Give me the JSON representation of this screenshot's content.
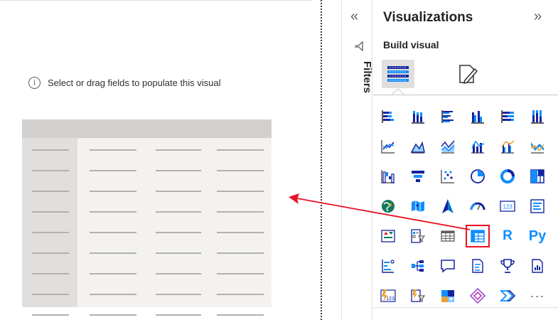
{
  "canvas": {
    "placeholder_text": "Select or drag fields to populate this visual",
    "table_placeholder": {
      "columns": 4,
      "rows": 9
    }
  },
  "filters_pane": {
    "label": "Filters",
    "collapse_glyph": "«"
  },
  "visualizations_pane": {
    "title": "Visualizations",
    "expand_glyph": "»",
    "build_visual_label": "Build visual",
    "tabs": [
      {
        "name": "build-visual",
        "icon": "build-visual-icon",
        "selected": true
      },
      {
        "name": "format-visual",
        "icon": "format-visual-icon",
        "selected": false
      }
    ],
    "gallery": [
      [
        {
          "name": "stacked-bar-chart",
          "icon": "stacked-bar-chart-icon"
        },
        {
          "name": "stacked-column-chart",
          "icon": "stacked-column-chart-icon"
        },
        {
          "name": "clustered-bar-chart",
          "icon": "clustered-bar-chart-icon"
        },
        {
          "name": "clustered-column-chart",
          "icon": "clustered-column-chart-icon"
        },
        {
          "name": "100-stacked-bar-chart",
          "icon": "100-stacked-bar-chart-icon"
        },
        {
          "name": "100-stacked-column-chart",
          "icon": "100-stacked-column-chart-icon"
        }
      ],
      [
        {
          "name": "line-chart",
          "icon": "line-chart-icon"
        },
        {
          "name": "area-chart",
          "icon": "area-chart-icon"
        },
        {
          "name": "stacked-area-chart",
          "icon": "stacked-area-chart-icon"
        },
        {
          "name": "line-and-stacked-column-chart",
          "icon": "line-and-stacked-column-chart-icon"
        },
        {
          "name": "line-and-clustered-column-chart",
          "icon": "line-and-clustered-column-chart-icon"
        },
        {
          "name": "ribbon-chart",
          "icon": "ribbon-chart-icon"
        }
      ],
      [
        {
          "name": "waterfall-chart",
          "icon": "waterfall-chart-icon"
        },
        {
          "name": "funnel",
          "icon": "funnel-icon"
        },
        {
          "name": "scatter-chart",
          "icon": "scatter-chart-icon"
        },
        {
          "name": "pie-chart",
          "icon": "pie-chart-icon"
        },
        {
          "name": "donut-chart",
          "icon": "donut-chart-icon"
        },
        {
          "name": "treemap",
          "icon": "treemap-icon"
        }
      ],
      [
        {
          "name": "map",
          "icon": "map-icon"
        },
        {
          "name": "filled-map",
          "icon": "filled-map-icon"
        },
        {
          "name": "azure-map",
          "icon": "azure-map-icon"
        },
        {
          "name": "gauge",
          "icon": "gauge-icon"
        },
        {
          "name": "card",
          "icon": "card-icon",
          "text": "123"
        },
        {
          "name": "multi-row-card",
          "icon": "multi-row-card-icon"
        }
      ],
      [
        {
          "name": "kpi",
          "icon": "kpi-icon"
        },
        {
          "name": "slicer",
          "icon": "slicer-icon"
        },
        {
          "name": "table",
          "icon": "table-icon"
        },
        {
          "name": "matrix",
          "icon": "matrix-icon",
          "selected": true
        },
        {
          "name": "r-script-visual",
          "icon": "r-icon",
          "text": "R"
        },
        {
          "name": "python-visual",
          "icon": "python-icon",
          "text": "Py"
        }
      ],
      [
        {
          "name": "key-influencers",
          "icon": "key-influencers-icon"
        },
        {
          "name": "decomposition-tree",
          "icon": "decomposition-tree-icon"
        },
        {
          "name": "qa",
          "icon": "qa-icon"
        },
        {
          "name": "smart-narrative",
          "icon": "smart-narrative-icon"
        },
        {
          "name": "metrics",
          "icon": "trophy-icon"
        },
        {
          "name": "paginated-report",
          "icon": "paginated-report-icon"
        }
      ],
      [
        {
          "name": "power-apps",
          "icon": "power-apps-icon",
          "text": "123"
        },
        {
          "name": "power-automate",
          "icon": "power-automate-icon"
        },
        {
          "name": "azure-ml",
          "icon": "azure-ml-icon"
        },
        {
          "name": "custom-visual-diamond",
          "icon": "diamond-icon"
        },
        {
          "name": "power-automate-flow",
          "icon": "chevrons-icon"
        },
        {
          "name": "more-visuals",
          "icon": "ellipsis-icon",
          "text": "···"
        }
      ]
    ]
  },
  "colors": {
    "accent_blue": "#118dff",
    "teal": "#12239e",
    "highlight_red": "#e81123",
    "arrow_red": "#e81123"
  }
}
